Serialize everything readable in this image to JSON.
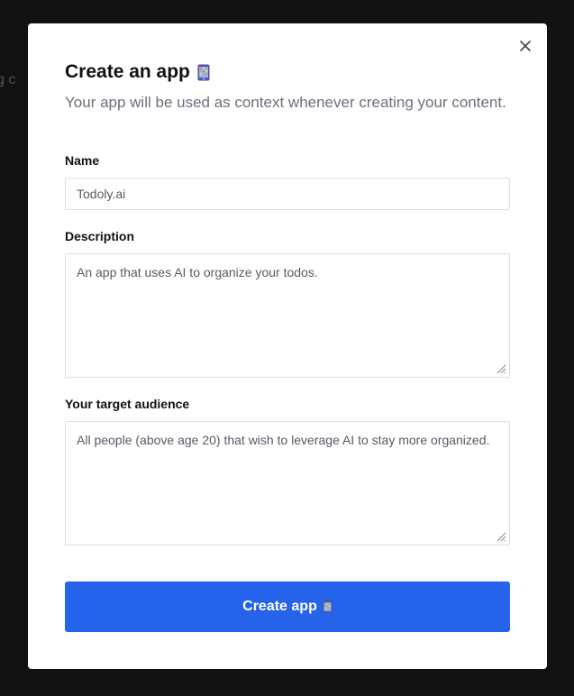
{
  "background": {
    "partial_text": "g c"
  },
  "modal": {
    "title": "Create an app",
    "title_icon": "mobile-phone-icon",
    "subtitle": "Your app will be used as context whenever creating your content.",
    "close_icon": "close-icon",
    "fields": {
      "name": {
        "label": "Name",
        "value": "Todoly.ai"
      },
      "description": {
        "label": "Description",
        "value": "An app that uses AI to organize your todos."
      },
      "audience": {
        "label": "Your target audience",
        "value": "All people (above age 20) that wish to leverage AI to stay more organized."
      }
    },
    "submit": {
      "label": "Create app",
      "icon": "mobile-phone-icon"
    }
  },
  "colors": {
    "overlay": "#111111",
    "primary": "#2563eb",
    "subtitle": "#6b6f7a",
    "border": "#dcdfe4"
  }
}
